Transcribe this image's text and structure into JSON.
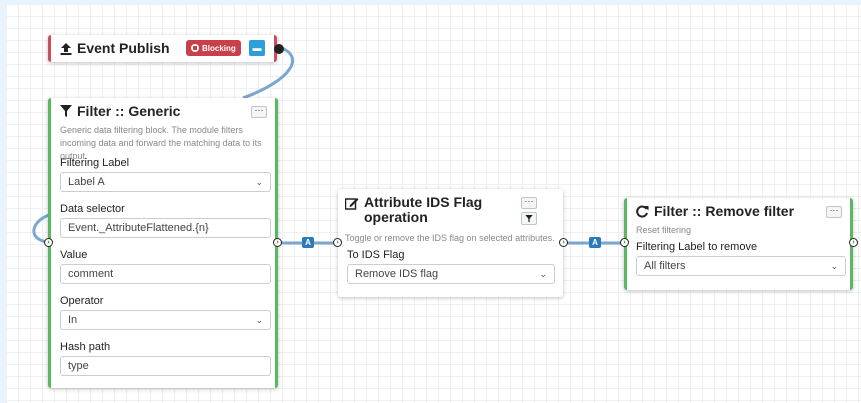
{
  "colors": {
    "wire": "#7aa6cf",
    "green_border": "#5cb85c",
    "red_border": "#c9505a",
    "blocking": "#c9404a",
    "accent_blue": "#2c7ab7"
  },
  "event_publish": {
    "title": "Event Publish",
    "icon": "upload-icon",
    "blocking_label": "Blocking",
    "chat_icon": "chat-icon"
  },
  "filter_generic": {
    "title": "Filter :: Generic",
    "icon": "funnel-icon",
    "more_label": "···",
    "description": "Generic data filtering block. The module filters incoming data and forward the matching data to its output.",
    "fields": {
      "filtering_label": {
        "label": "Filtering Label",
        "value": "Label A"
      },
      "data_selector": {
        "label": "Data selector",
        "value": "Event._AttributeFlattened.{n}"
      },
      "value": {
        "label": "Value",
        "value": "comment"
      },
      "operator": {
        "label": "Operator",
        "value": "In"
      },
      "hash_path": {
        "label": "Hash path",
        "value": "type"
      }
    }
  },
  "attr_ids": {
    "title": "Attribute IDS Flag operation",
    "icon": "edit-icon",
    "more_label": "···",
    "filter_icon": "funnel-icon",
    "description": "Toggle or remove the IDS flag on selected attributes.",
    "field": {
      "label": "To IDS Flag",
      "value": "Remove IDS flag"
    }
  },
  "remove_filter": {
    "title": "Filter :: Remove filter",
    "icon": "redo-icon",
    "more_label": "···",
    "description": "Reset filtering",
    "field": {
      "label": "Filtering Label to remove",
      "value": "All filters"
    }
  },
  "connections": {
    "badge_1": "A",
    "badge_2": "A"
  }
}
